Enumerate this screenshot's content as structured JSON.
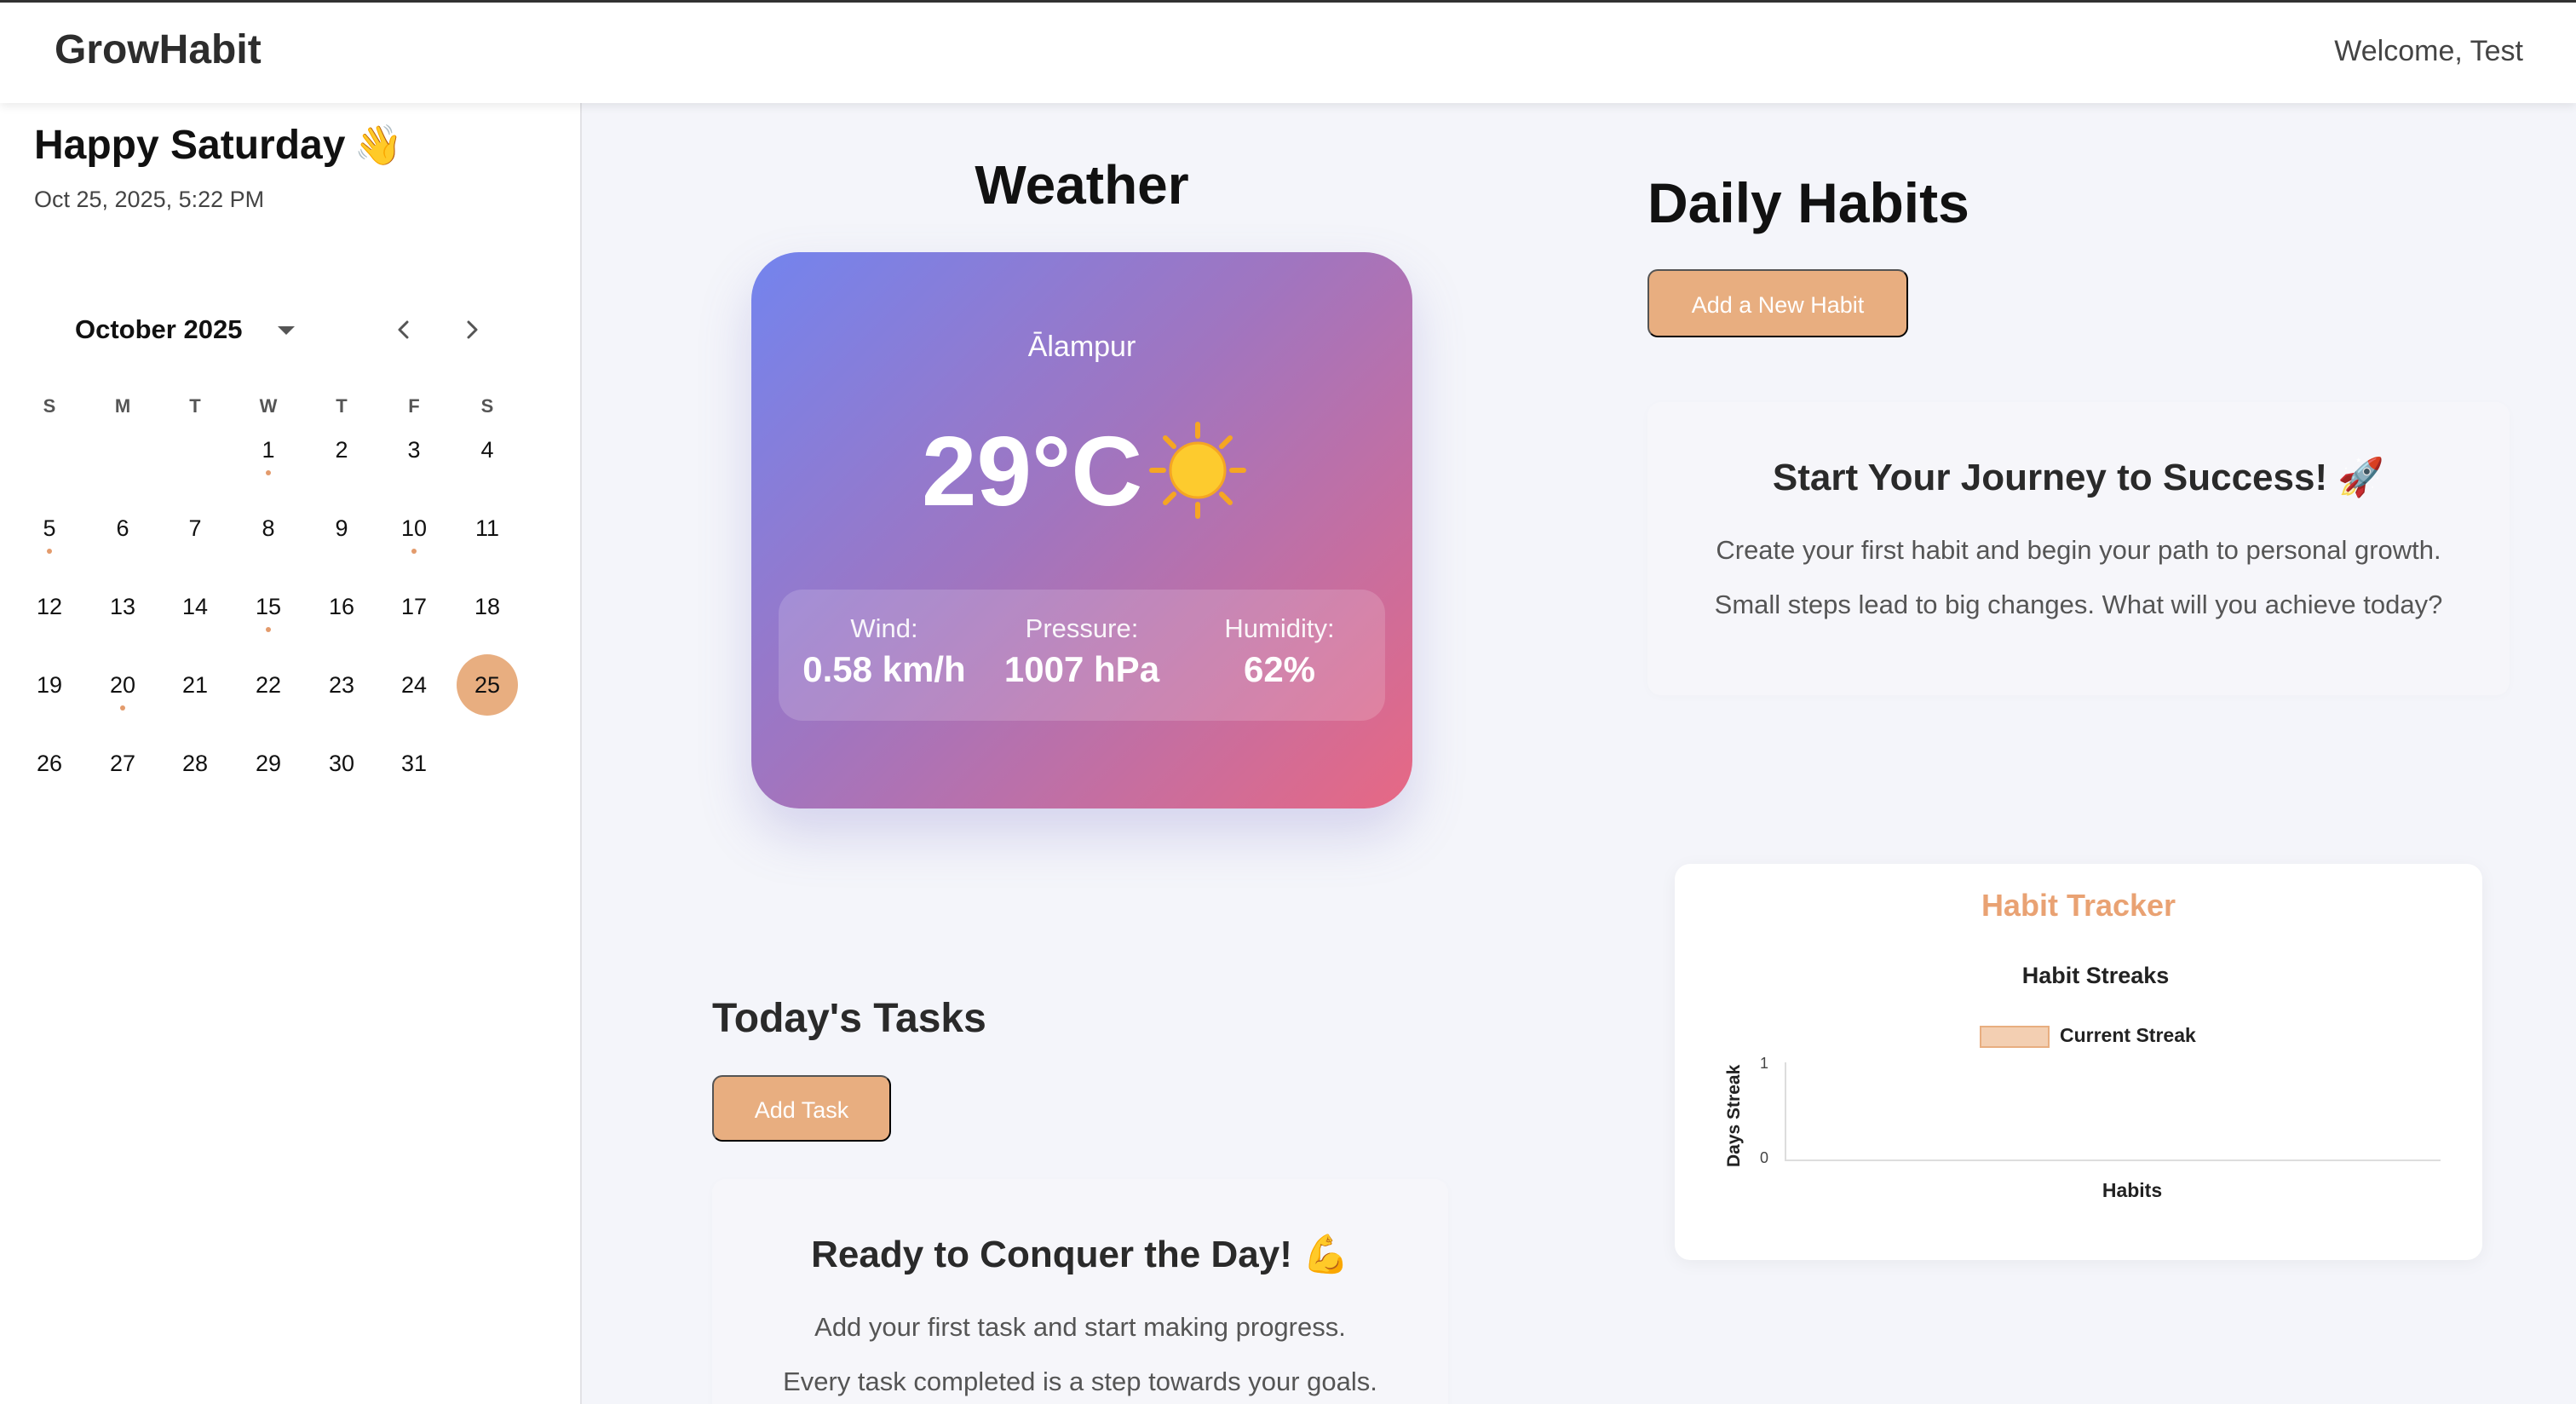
{
  "app": {
    "brand": "GrowHabit",
    "welcome": "Welcome, Test"
  },
  "sidebar": {
    "greeting": "Happy Saturday",
    "greeting_emoji": "👋",
    "datetime": "Oct 25, 2025, 5:22 PM",
    "calendar": {
      "month_label": "October 2025",
      "weekdays": [
        "S",
        "M",
        "T",
        "W",
        "T",
        "F",
        "S"
      ],
      "days": [
        "1",
        "2",
        "3",
        "4",
        "5",
        "6",
        "7",
        "8",
        "9",
        "10",
        "11",
        "12",
        "13",
        "14",
        "15",
        "16",
        "17",
        "18",
        "19",
        "20",
        "21",
        "22",
        "23",
        "24",
        "25",
        "26",
        "27",
        "28",
        "29",
        "30",
        "31"
      ],
      "selected_day": "25",
      "marked_days": [
        "1",
        "5",
        "10",
        "15",
        "20"
      ],
      "accent_color": "#e8ae80"
    }
  },
  "weather": {
    "title": "Weather",
    "city": "Ālampur",
    "temperature": "29°C",
    "condition_icon": "sun-icon",
    "wind_label": "Wind:",
    "wind_value": "0.58 km/h",
    "pressure_label": "Pressure:",
    "pressure_value": "1007 hPa",
    "humidity_label": "Humidity:",
    "humidity_value": "62%"
  },
  "habits": {
    "title": "Daily Habits",
    "add_button": "Add a New Habit",
    "empty_heading": "Start Your Journey to Success! 🚀",
    "empty_line1": "Create your first habit and begin your path to personal growth.",
    "empty_line2": "Small steps lead to big changes. What will you achieve today?"
  },
  "tracker": {
    "title": "Habit Tracker",
    "chart_data": {
      "type": "bar",
      "title": "Habit Streaks",
      "categories": [],
      "series": [
        {
          "name": "Current Streak",
          "values": []
        }
      ],
      "xlabel": "Habits",
      "ylabel": "Days Streak",
      "ylim": [
        0,
        1
      ],
      "yticks": [
        "1",
        "0"
      ],
      "legend": "top-center",
      "bar_color": "#f3cfb2"
    }
  },
  "tasks": {
    "title": "Today's Tasks",
    "add_button": "Add Task",
    "empty_heading": "Ready to Conquer the Day! 💪",
    "empty_line1": "Add your first task and start making progress.",
    "empty_line2": "Every task completed is a step towards your goals."
  }
}
